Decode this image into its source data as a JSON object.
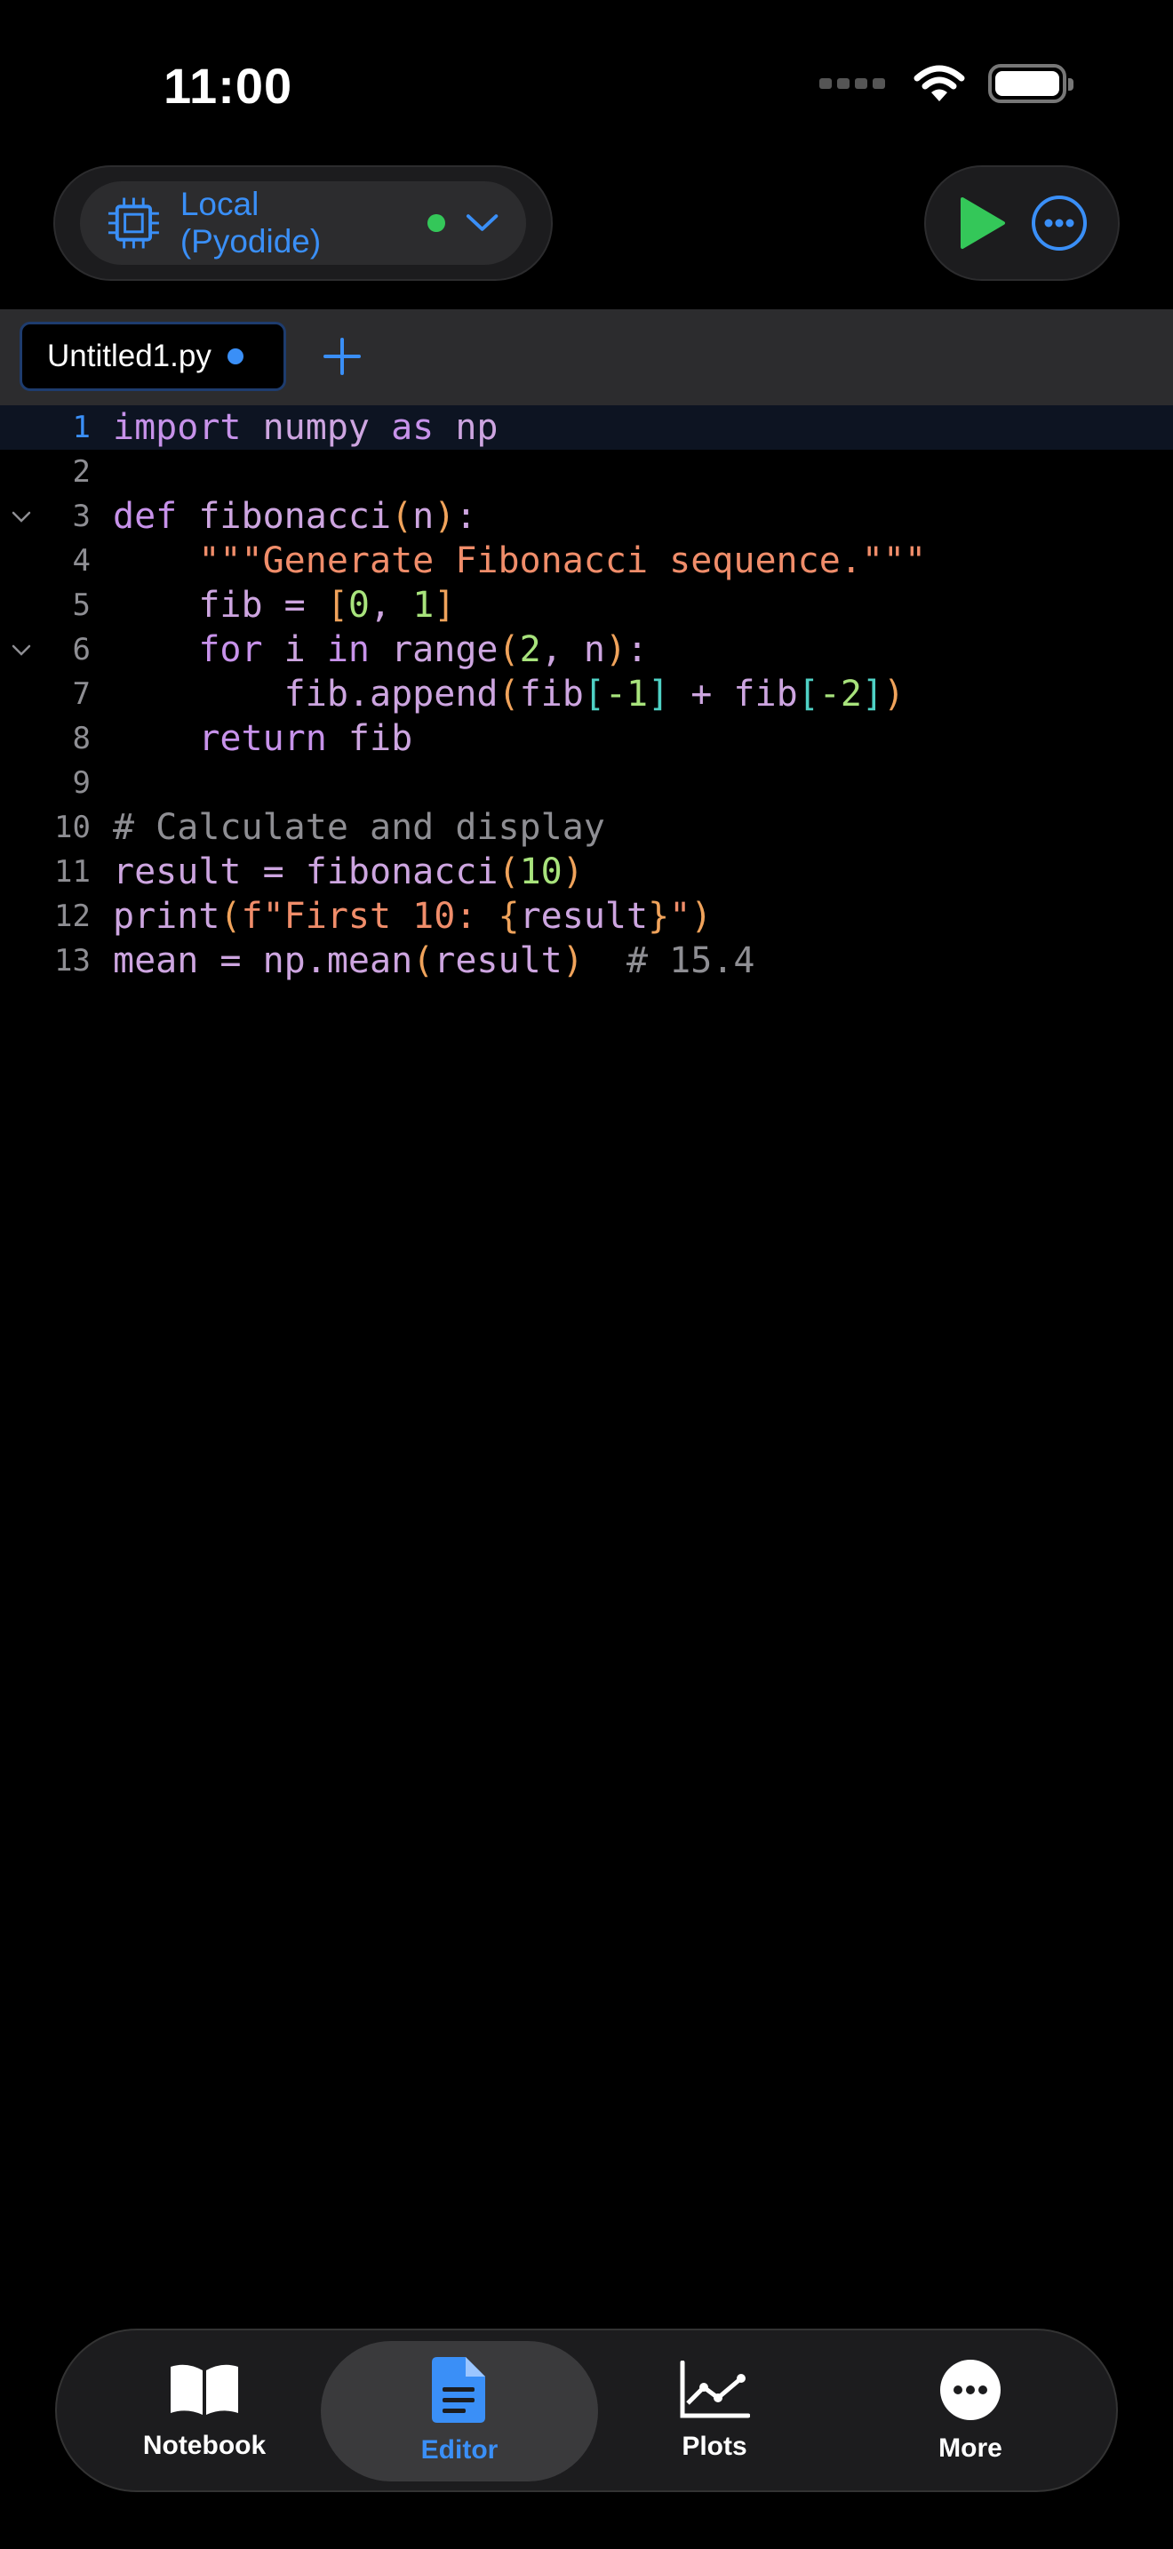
{
  "status_bar": {
    "time": "11:00"
  },
  "kernel": {
    "label": "Local (Pyodide)",
    "status_color": "#34c759"
  },
  "tabs": [
    {
      "name": "Untitled1.py",
      "unsaved": true
    }
  ],
  "editor": {
    "lines": [
      {
        "n": "1",
        "html": "<span class=\"kw\">import</span> numpy <span class=\"kw\">as</span> np"
      },
      {
        "n": "2",
        "html": ""
      },
      {
        "n": "3",
        "html": "<span class=\"kw\">def</span> fibonacci<span class=\"pa\">(</span>n<span class=\"pa\">)</span>:"
      },
      {
        "n": "4",
        "html": "    <span class=\"str\">\"\"\"Generate Fibonacci sequence.\"\"\"</span>"
      },
      {
        "n": "5",
        "html": "    fib = <span class=\"pa\">[</span><span class=\"num\">0</span>, <span class=\"num\">1</span><span class=\"pa\">]</span>"
      },
      {
        "n": "6",
        "html": "    <span class=\"kw\">for</span> i <span class=\"kw\">in</span> range<span class=\"pa\">(</span><span class=\"num\">2</span>, n<span class=\"pa\">)</span>:"
      },
      {
        "n": "7",
        "html": "        fib.append<span class=\"pa\">(</span>fib<span class=\"br\">[</span><span class=\"num\">-1</span><span class=\"br\">]</span> + fib<span class=\"br\">[</span><span class=\"num\">-2</span><span class=\"br\">]</span><span class=\"pa\">)</span>"
      },
      {
        "n": "8",
        "html": "    <span class=\"kw\">return</span> fib"
      },
      {
        "n": "9",
        "html": ""
      },
      {
        "n": "10",
        "html": "<span class=\"cm\"># Calculate and display</span>"
      },
      {
        "n": "11",
        "html": "result = fibonacci<span class=\"pa\">(</span><span class=\"num\">10</span><span class=\"pa\">)</span>"
      },
      {
        "n": "12",
        "html": "print<span class=\"pa\">(</span><span class=\"str\">f\"First 10: </span><span class=\"pa\">{</span>result<span class=\"pa\">}</span><span class=\"str\">\"</span><span class=\"pa\">)</span>"
      },
      {
        "n": "13",
        "html": "mean = np.mean<span class=\"pa\">(</span>result<span class=\"pa\">)</span>  <span class=\"cm\"># 15.4</span>"
      }
    ],
    "active_line": "1",
    "foldable_lines": [
      "3",
      "6"
    ]
  },
  "bottom_nav": {
    "items": [
      {
        "label": "Notebook",
        "icon": "book-icon"
      },
      {
        "label": "Editor",
        "icon": "document-icon",
        "selected": true
      },
      {
        "label": "Plots",
        "icon": "chart-icon"
      },
      {
        "label": "More",
        "icon": "more-icon"
      }
    ]
  },
  "colors": {
    "accent": "#3a8ff7",
    "run": "#34c759",
    "background": "#000000"
  }
}
